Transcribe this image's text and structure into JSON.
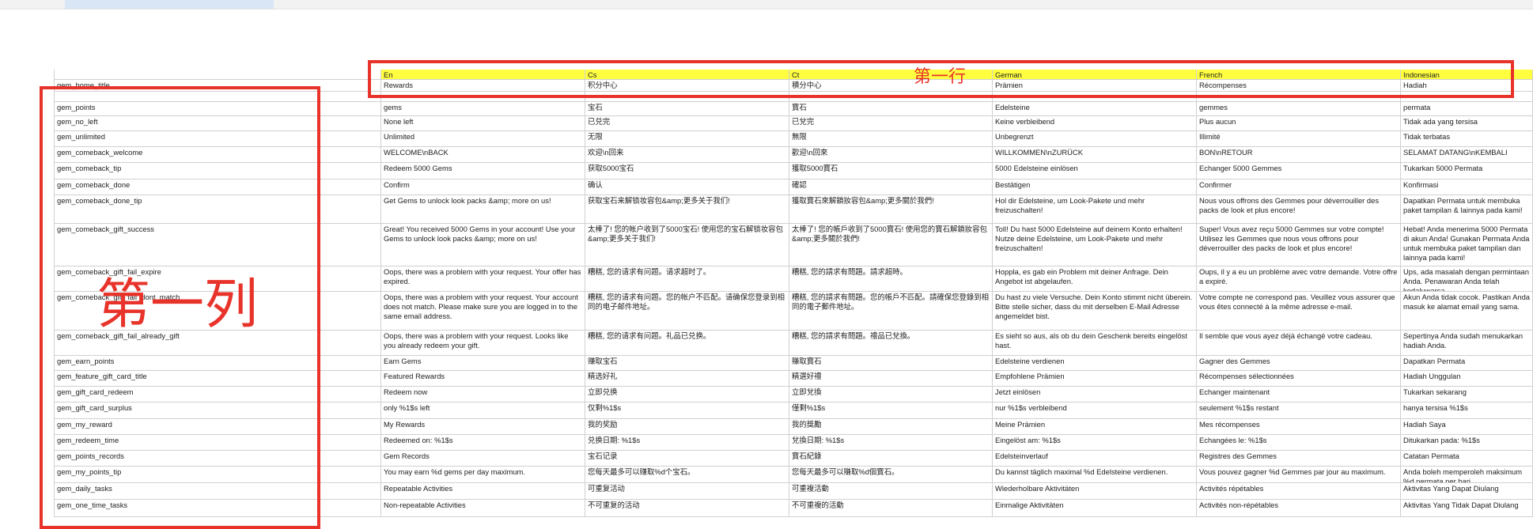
{
  "columns": [
    {
      "label": ""
    },
    {
      "label": "En"
    },
    {
      "label": "Cs"
    },
    {
      "label": "Ct"
    },
    {
      "label": "German"
    },
    {
      "label": "French"
    },
    {
      "label": "Indonesian"
    }
  ],
  "rows": [
    {
      "cells": [
        "gem_home_title",
        "Rewards",
        "积分中心",
        "積分中心",
        "Prämien",
        "Récompenses",
        "Hadiah"
      ]
    },
    {
      "cells": [
        "",
        "",
        "",
        "",
        "",
        "",
        ""
      ]
    },
    {
      "cells": [
        "gem_points",
        "gems",
        "宝石",
        "寶石",
        "Edelsteine",
        "gemmes",
        "permata"
      ]
    },
    {
      "cells": [
        "gem_no_left",
        "None left",
        "已兑完",
        "已兌完",
        "Keine verbleibend",
        "Plus aucun",
        "Tidak ada yang tersisa"
      ]
    },
    {
      "cells": [
        "gem_unlimited",
        "Unlimited",
        "无限",
        "無限",
        "Unbegrenzt",
        "Illimité",
        "Tidak terbatas"
      ]
    },
    {
      "cells": [
        "gem_comeback_welcome",
        "WELCOME\\nBACK",
        "欢迎\\n回来",
        "歡迎\\n回來",
        "WILLKOMMEN\\nZURÜCK",
        "BON\\nRETOUR",
        "SELAMAT DATANG\\nKEMBALI"
      ]
    },
    {
      "cells": [
        "gem_comeback_tip",
        "Redeem 5000 Gems",
        "获取5000宝石",
        "獲取5000寶石",
        "5000 Edelsteine einlösen",
        "Echanger 5000 Gemmes",
        "Tukarkan 5000 Permata"
      ]
    },
    {
      "cells": [
        "gem_comeback_done",
        "Confirm",
        "确认",
        "確認",
        "Bestätigen",
        "Confirmer",
        "Konfirmasi"
      ]
    },
    {
      "cells": [
        "gem_comeback_done_tip",
        "Get Gems to unlock look packs &amp; more on us!",
        "获取宝石来解锁妆容包&amp;更多关于我们!",
        "獲取寶石來解鎖妝容包&amp;更多關於我們!",
        "Hol dir Edelsteine, um Look-Pakete und mehr freizuschalten!",
        "Nous vous offrons des Gemmes pour déverrouiller des packs de look et plus encore!",
        "Dapatkan Permata untuk membuka paket tampilan & lainnya pada kami!"
      ]
    },
    {
      "cells": [
        "gem_comeback_gift_success",
        "Great! You received 5000 Gems in your account! Use your Gems to unlock look packs &amp; more on us!",
        "太棒了! 您的帐户收到了5000宝石! 使用您的宝石解锁妆容包&amp;更多关于我们!",
        "太棒了! 您的帳戶收到了5000寶石! 使用您的寶石解鎖妝容包&amp;更多關於我們!",
        "Toll! Du hast 5000 Edelsteine auf deinem Konto erhalten! Nutze deine Edelsteine, um Look-Pakete und mehr freizuschalten!",
        "Super! Vous avez reçu 5000 Gemmes sur votre compte! Utilisez les Gemmes que nous vous offrons pour déverrouiller des packs de look et plus encore!",
        "Hebat! Anda menerima 5000 Permata di akun Anda! Gunakan Permata Anda untuk membuka paket tampilan dan lainnya pada kami!"
      ]
    },
    {
      "cells": [
        "gem_comeback_gift_fail_expire",
        "Oops, there was a problem with your request. Your offer has expired.",
        "糟糕, 您的请求有问题。请求超时了。",
        "糟糕, 您的請求有問題。請求超時。",
        "Hoppla, es gab ein Problem mit deiner Anfrage. Dein Angebot ist abgelaufen.",
        "Oups, il y a eu un problème avec votre demande. Votre offre a expiré.",
        "Ups, ada masalah dengan permintaan Anda. Penawaran Anda telah kedaluwarsa."
      ]
    },
    {
      "cells": [
        "gem_comeback_gift_fail_dont_match",
        "Oops, there was a problem with your request. Your account does not match. Please make sure you are logged in to the same email address.",
        "糟糕, 您的请求有问题。您的帐户不匹配。请确保您登录到相同的电子邮件地址。",
        "糟糕, 您的請求有問題。您的帳戶不匹配。請確保您登錄到相同的電子郵件地址。",
        "Du hast zu viele Versuche. Dein Konto stimmt nicht überein. Bitte stelle sicher, dass du mit derselben E-Mail Adresse angemeldet bist.",
        "Votre compte ne correspond pas. Veuillez vous assurer que vous êtes connecté à la même adresse e-mail.",
        "Akun Anda tidak cocok. Pastikan Anda masuk ke alamat email yang sama."
      ]
    },
    {
      "cells": [
        "gem_comeback_gift_fail_already_gift",
        "Oops, there was a problem with your request. Looks like you already redeem your gift.",
        "糟糕, 您的请求有问题。礼品已兑换。",
        "糟糕, 您的請求有問題。禮品已兌換。",
        "Es sieht so aus, als ob du dein Geschenk bereits eingelöst hast.",
        "Il semble que vous ayez déjà échangé votre cadeau.",
        "Sepertinya Anda sudah menukarkan hadiah Anda."
      ]
    },
    {
      "cells": [
        "gem_earn_points",
        "Earn Gems",
        "赚取宝石",
        "賺取寶石",
        "Edelsteine verdienen",
        "Gagner des Gemmes",
        "Dapatkan Permata"
      ]
    },
    {
      "cells": [
        "gem_feature_gift_card_title",
        "Featured Rewards",
        "精选好礼",
        "精選好禮",
        "Empfohlene Prämien",
        "Récompenses sélectionnées",
        "Hadiah Unggulan"
      ]
    },
    {
      "cells": [
        "gem_gift_card_redeem",
        "Redeem now",
        "立即兑换",
        "立即兌換",
        "Jetzt einlösen",
        "Echanger maintenant",
        "Tukarkan sekarang"
      ]
    },
    {
      "cells": [
        "gem_gift_card_surplus",
        "only %1$s left",
        "仅剩%1$s",
        "僅剩%1$s",
        "nur %1$s verbleibend",
        "seulement %1$s restant",
        "hanya tersisa %1$s"
      ]
    },
    {
      "cells": [
        "gem_my_reward",
        "My Rewards",
        "我的奖励",
        "我的獎勵",
        "Meine Prämien",
        "Mes récompenses",
        "Hadiah Saya"
      ]
    },
    {
      "cells": [
        "gem_redeem_time",
        "Redeemed on: %1$s",
        "兑换日期: %1$s",
        "兌換日期: %1$s",
        "Eingelöst am: %1$s",
        "Echangées le: %1$s",
        "Ditukarkan pada: %1$s"
      ]
    },
    {
      "cells": [
        "gem_points_records",
        "Gem Records",
        "宝石记录",
        "寶石紀錄",
        "Edelsteinverlauf",
        "Registres des Gemmes",
        "Catatan Permata"
      ]
    },
    {
      "cells": [
        "gem_my_points_tip",
        "You may earn %d gems per day maximum.",
        "您每天最多可以赚取%d个宝石。",
        "您每天最多可以賺取%d個寶石。",
        "Du kannst täglich maximal %d Edelsteine verdienen.",
        "Vous pouvez gagner %d Gemmes par jour au maximum.",
        "Anda boleh memperoleh maksimum %d permata per hari."
      ]
    },
    {
      "cells": [
        "gem_daily_tasks",
        "Repeatable Activities",
        "可重复活动",
        "可重複活動",
        "Wiederholbare Aktivitäten",
        "Activités répétables",
        "Aktivitas Yang Dapat Diulang"
      ]
    },
    {
      "cells": [
        "gem_one_time_tasks",
        "Non-repeatable Activities",
        "不可重复的活动",
        "不可重複的活動",
        "Einmalige Aktivitäten",
        "Activités non-répétables",
        "Aktivitas Yang Tidak Dapat Diulang"
      ]
    }
  ],
  "annotations": {
    "row_label": "第一行",
    "column_label": "第一列",
    "color": "#e8332a"
  },
  "colors": {
    "header_fill": "#ffff40",
    "grid_line": "#d0d0d0"
  }
}
